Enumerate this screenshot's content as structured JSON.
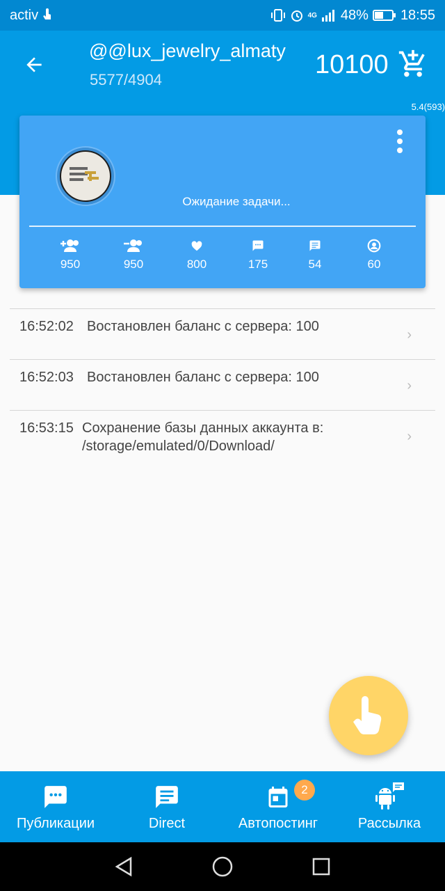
{
  "status_bar": {
    "carrier": "activ",
    "network": "4G",
    "battery": "48%",
    "time": "18:55"
  },
  "header": {
    "account": "@@lux_jewelry_almaty",
    "counts": "5577/4904",
    "balance": "10100",
    "version": "5.4(593)"
  },
  "card": {
    "status": "Ожидание задачи...",
    "stats": [
      {
        "icon": "person-add-icon",
        "value": "950"
      },
      {
        "icon": "person-remove-icon",
        "value": "950"
      },
      {
        "icon": "heart-icon",
        "value": "800"
      },
      {
        "icon": "comment-icon",
        "value": "175"
      },
      {
        "icon": "message-icon",
        "value": "54"
      },
      {
        "icon": "profile-view-icon",
        "value": "60"
      }
    ]
  },
  "log": [
    {
      "time": "16:52:02",
      "message": "Востановлен баланс с сервера: 100"
    },
    {
      "time": "16:52:03",
      "message": "Востановлен баланс с сервера: 100"
    },
    {
      "time": "16:53:15",
      "message": "Сохранение базы данных аккаунта в: /storage/emulated/0/Download/"
    }
  ],
  "bottom_nav": {
    "items": [
      {
        "label": "Публикации",
        "icon": "chat-icon"
      },
      {
        "label": "Direct",
        "icon": "message-icon"
      },
      {
        "label": "Автопостинг",
        "icon": "calendar-icon",
        "badge": "2"
      },
      {
        "label": "Рассылка",
        "icon": "android-icon"
      }
    ]
  },
  "colors": {
    "primary": "#039be5",
    "card": "#42a5f5",
    "fab": "#ffd567",
    "badge": "#ffa94d"
  }
}
